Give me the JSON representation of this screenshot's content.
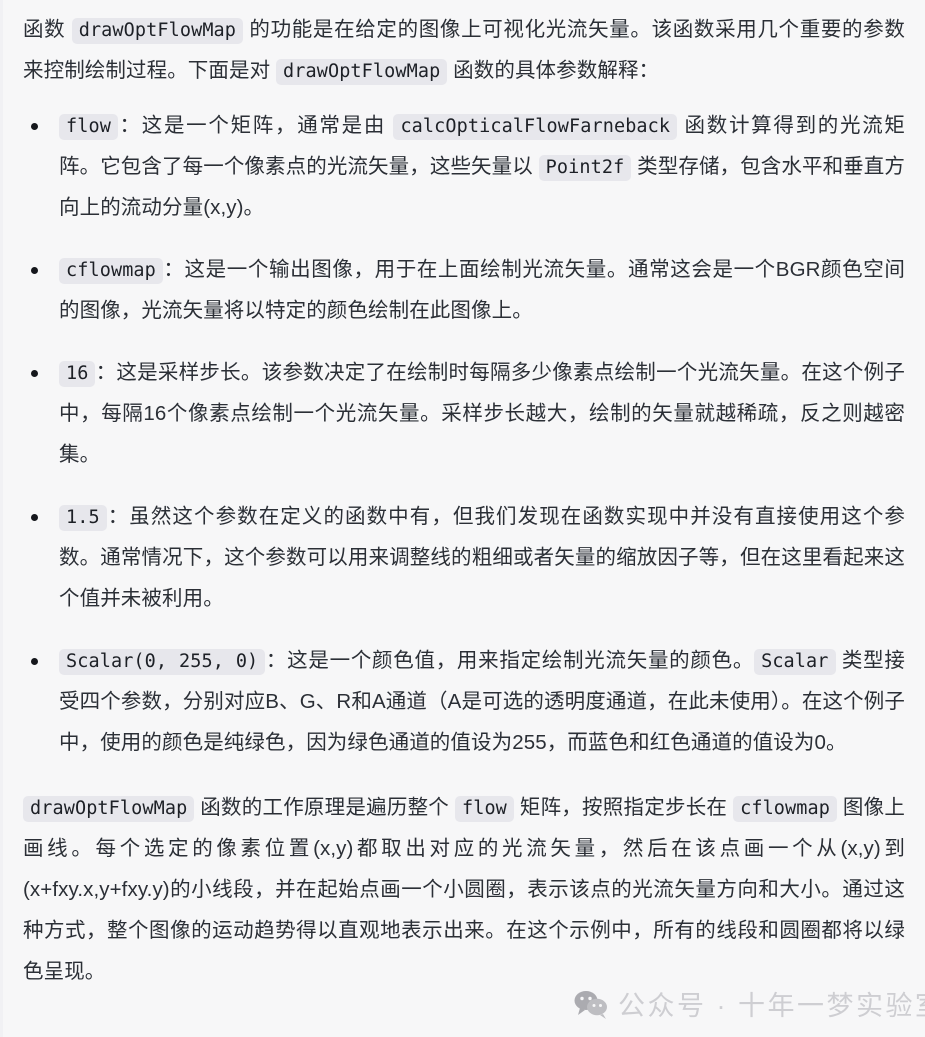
{
  "document": {
    "background_color": "#f7f7f8",
    "text_color": "#2b2f36",
    "code_background_color": "#e7e7ec",
    "intro": {
      "seg1": "函数 ",
      "code1": "drawOptFlowMap",
      "seg2": " 的功能是在给定的图像上可视化光流矢量。该函数采用几个重要的参数来控制绘制过程。下面是对 ",
      "code2": "drawOptFlowMap",
      "seg3": " 函数的具体参数解释："
    },
    "bullets": [
      {
        "code": "flow",
        "seg1": "：这是一个矩阵，通常是由 ",
        "code2": "calcOpticalFlowFarneback",
        "seg2": " 函数计算得到的光流矩阵。它包含了每一个像素点的光流矢量，这些矢量以 ",
        "code3": "Point2f",
        "seg3": " 类型存储，包含水平和垂直方向上的流动分量(x,y)。"
      },
      {
        "code": "cflowmap",
        "seg1": "：这是一个输出图像，用于在上面绘制光流矢量。通常这会是一个BGR颜色空间的图像，光流矢量将以特定的颜色绘制在此图像上。"
      },
      {
        "code": "16",
        "seg1": "：这是采样步长。该参数决定了在绘制时每隔多少像素点绘制一个光流矢量。在这个例子中，每隔16个像素点绘制一个光流矢量。采样步长越大，绘制的矢量就越稀疏，反之则越密集。"
      },
      {
        "code": "1.5",
        "seg1": "：虽然这个参数在定义的函数中有，但我们发现在函数实现中并没有直接使用这个参数。通常情况下，这个参数可以用来调整线的粗细或者矢量的缩放因子等，但在这里看起来这个值并未被利用。"
      },
      {
        "code": "Scalar(0, 255, 0)",
        "seg1": "：这是一个颜色值，用来指定绘制光流矢量的颜色。",
        "code2": "Scalar",
        "seg2": " 类型接受四个参数，分别对应B、G、R和A通道（A是可选的透明度通道，在此未使用）。在这个例子中，使用的颜色是纯绿色，因为绿色通道的值设为255，而蓝色和红色通道的值设为0。"
      }
    ],
    "closing": {
      "code1": "drawOptFlowMap",
      "seg1": " 函数的工作原理是遍历整个 ",
      "code2": "flow",
      "seg2": " 矩阵，按照指定步长在 ",
      "code3": "cflowmap",
      "seg3": " 图像上画线。每个选定的像素位置(x,y)都取出对应的光流矢量，然后在该点画一个从(x,y)到(x+fxy.x,y+fxy.y)的小线段，并在起始点画一个小圆圈，表示该点的光流矢量方向和大小。通过这种方式，整个图像的运动趋势得以直观地表示出来。在这个示例中，所有的线段和圆圈都将以绿色呈现。"
    }
  },
  "watermark": {
    "icon": "wechat-bubble-icon",
    "text": "公众号 · 十年一梦实验室",
    "color": "#bfbfc4"
  }
}
